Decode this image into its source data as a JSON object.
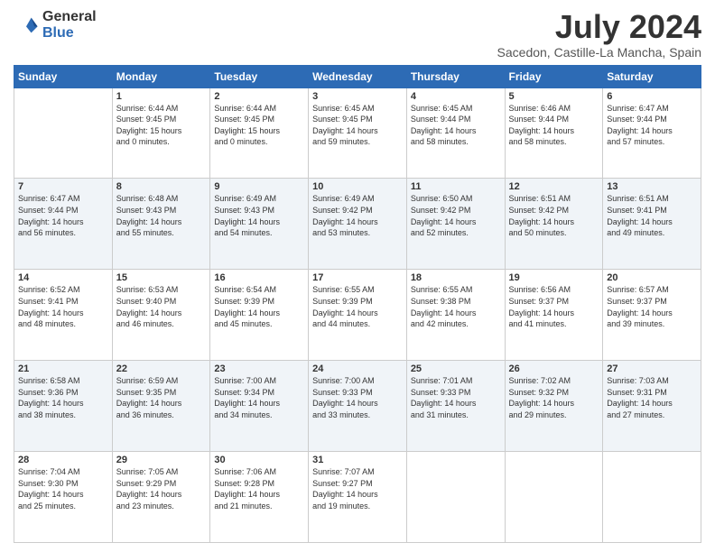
{
  "logo": {
    "general": "General",
    "blue": "Blue"
  },
  "title": "July 2024",
  "subtitle": "Sacedon, Castille-La Mancha, Spain",
  "headers": [
    "Sunday",
    "Monday",
    "Tuesday",
    "Wednesday",
    "Thursday",
    "Friday",
    "Saturday"
  ],
  "weeks": [
    [
      {
        "day": "",
        "info": ""
      },
      {
        "day": "1",
        "info": "Sunrise: 6:44 AM\nSunset: 9:45 PM\nDaylight: 15 hours\nand 0 minutes."
      },
      {
        "day": "2",
        "info": "Sunrise: 6:44 AM\nSunset: 9:45 PM\nDaylight: 15 hours\nand 0 minutes."
      },
      {
        "day": "3",
        "info": "Sunrise: 6:45 AM\nSunset: 9:45 PM\nDaylight: 14 hours\nand 59 minutes."
      },
      {
        "day": "4",
        "info": "Sunrise: 6:45 AM\nSunset: 9:44 PM\nDaylight: 14 hours\nand 58 minutes."
      },
      {
        "day": "5",
        "info": "Sunrise: 6:46 AM\nSunset: 9:44 PM\nDaylight: 14 hours\nand 58 minutes."
      },
      {
        "day": "6",
        "info": "Sunrise: 6:47 AM\nSunset: 9:44 PM\nDaylight: 14 hours\nand 57 minutes."
      }
    ],
    [
      {
        "day": "7",
        "info": "Sunrise: 6:47 AM\nSunset: 9:44 PM\nDaylight: 14 hours\nand 56 minutes."
      },
      {
        "day": "8",
        "info": "Sunrise: 6:48 AM\nSunset: 9:43 PM\nDaylight: 14 hours\nand 55 minutes."
      },
      {
        "day": "9",
        "info": "Sunrise: 6:49 AM\nSunset: 9:43 PM\nDaylight: 14 hours\nand 54 minutes."
      },
      {
        "day": "10",
        "info": "Sunrise: 6:49 AM\nSunset: 9:42 PM\nDaylight: 14 hours\nand 53 minutes."
      },
      {
        "day": "11",
        "info": "Sunrise: 6:50 AM\nSunset: 9:42 PM\nDaylight: 14 hours\nand 52 minutes."
      },
      {
        "day": "12",
        "info": "Sunrise: 6:51 AM\nSunset: 9:42 PM\nDaylight: 14 hours\nand 50 minutes."
      },
      {
        "day": "13",
        "info": "Sunrise: 6:51 AM\nSunset: 9:41 PM\nDaylight: 14 hours\nand 49 minutes."
      }
    ],
    [
      {
        "day": "14",
        "info": "Sunrise: 6:52 AM\nSunset: 9:41 PM\nDaylight: 14 hours\nand 48 minutes."
      },
      {
        "day": "15",
        "info": "Sunrise: 6:53 AM\nSunset: 9:40 PM\nDaylight: 14 hours\nand 46 minutes."
      },
      {
        "day": "16",
        "info": "Sunrise: 6:54 AM\nSunset: 9:39 PM\nDaylight: 14 hours\nand 45 minutes."
      },
      {
        "day": "17",
        "info": "Sunrise: 6:55 AM\nSunset: 9:39 PM\nDaylight: 14 hours\nand 44 minutes."
      },
      {
        "day": "18",
        "info": "Sunrise: 6:55 AM\nSunset: 9:38 PM\nDaylight: 14 hours\nand 42 minutes."
      },
      {
        "day": "19",
        "info": "Sunrise: 6:56 AM\nSunset: 9:37 PM\nDaylight: 14 hours\nand 41 minutes."
      },
      {
        "day": "20",
        "info": "Sunrise: 6:57 AM\nSunset: 9:37 PM\nDaylight: 14 hours\nand 39 minutes."
      }
    ],
    [
      {
        "day": "21",
        "info": "Sunrise: 6:58 AM\nSunset: 9:36 PM\nDaylight: 14 hours\nand 38 minutes."
      },
      {
        "day": "22",
        "info": "Sunrise: 6:59 AM\nSunset: 9:35 PM\nDaylight: 14 hours\nand 36 minutes."
      },
      {
        "day": "23",
        "info": "Sunrise: 7:00 AM\nSunset: 9:34 PM\nDaylight: 14 hours\nand 34 minutes."
      },
      {
        "day": "24",
        "info": "Sunrise: 7:00 AM\nSunset: 9:33 PM\nDaylight: 14 hours\nand 33 minutes."
      },
      {
        "day": "25",
        "info": "Sunrise: 7:01 AM\nSunset: 9:33 PM\nDaylight: 14 hours\nand 31 minutes."
      },
      {
        "day": "26",
        "info": "Sunrise: 7:02 AM\nSunset: 9:32 PM\nDaylight: 14 hours\nand 29 minutes."
      },
      {
        "day": "27",
        "info": "Sunrise: 7:03 AM\nSunset: 9:31 PM\nDaylight: 14 hours\nand 27 minutes."
      }
    ],
    [
      {
        "day": "28",
        "info": "Sunrise: 7:04 AM\nSunset: 9:30 PM\nDaylight: 14 hours\nand 25 minutes."
      },
      {
        "day": "29",
        "info": "Sunrise: 7:05 AM\nSunset: 9:29 PM\nDaylight: 14 hours\nand 23 minutes."
      },
      {
        "day": "30",
        "info": "Sunrise: 7:06 AM\nSunset: 9:28 PM\nDaylight: 14 hours\nand 21 minutes."
      },
      {
        "day": "31",
        "info": "Sunrise: 7:07 AM\nSunset: 9:27 PM\nDaylight: 14 hours\nand 19 minutes."
      },
      {
        "day": "",
        "info": ""
      },
      {
        "day": "",
        "info": ""
      },
      {
        "day": "",
        "info": ""
      }
    ]
  ]
}
